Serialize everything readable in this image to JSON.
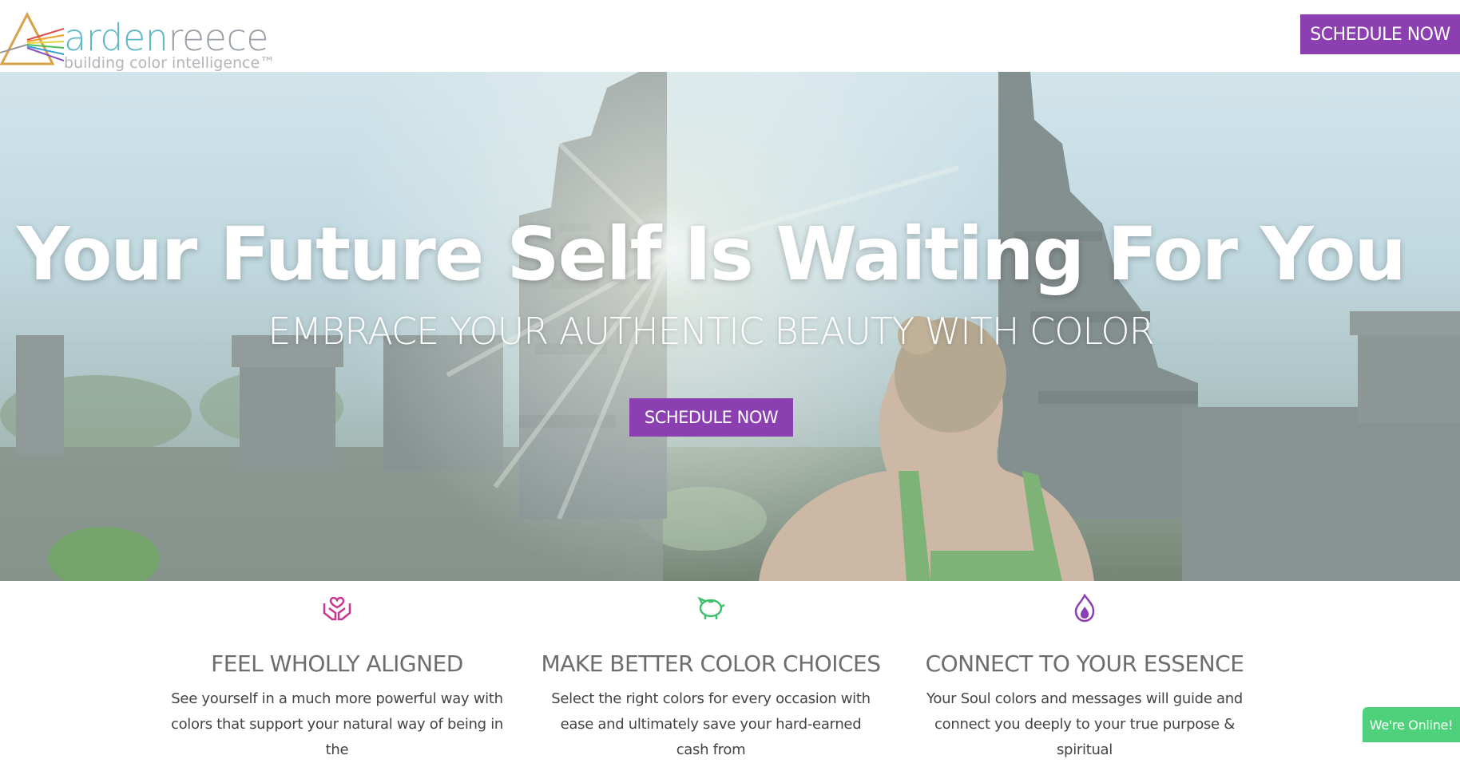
{
  "header": {
    "logo_primary": "arden",
    "logo_secondary": "reece",
    "tagline": "building color intelligence™",
    "cta_label": "SCHEDULE NOW"
  },
  "hero": {
    "title": "Your Future Self Is Waiting For You",
    "subtitle": "EMBRACE YOUR AUTHENTIC BEAUTY WITH COLOR",
    "cta_label": "SCHEDULE NOW"
  },
  "features": [
    {
      "icon": "hands-heart-icon",
      "icon_color": "#c8378f",
      "title": "FEEL WHOLLY ALIGNED",
      "text": "See yourself in a much more powerful way with colors that support your natural way of being in the"
    },
    {
      "icon": "piggy-bank-icon",
      "icon_color": "#3fbf6a",
      "title": "MAKE BETTER COLOR CHOICES",
      "text": "Select the right colors for every occasion with ease and ultimately save your hard-earned cash from"
    },
    {
      "icon": "flame-icon",
      "icon_color": "#8b3fb0",
      "title": "CONNECT TO YOUR ESSENCE",
      "text": "Your Soul colors and messages will guide and connect you deeply to your true purpose & spiritual"
    }
  ],
  "chat": {
    "label": "We're Online!"
  },
  "colors": {
    "accent": "#8b3fb0",
    "online": "#4fd17c",
    "logo_teal": "#5fb8c8"
  }
}
